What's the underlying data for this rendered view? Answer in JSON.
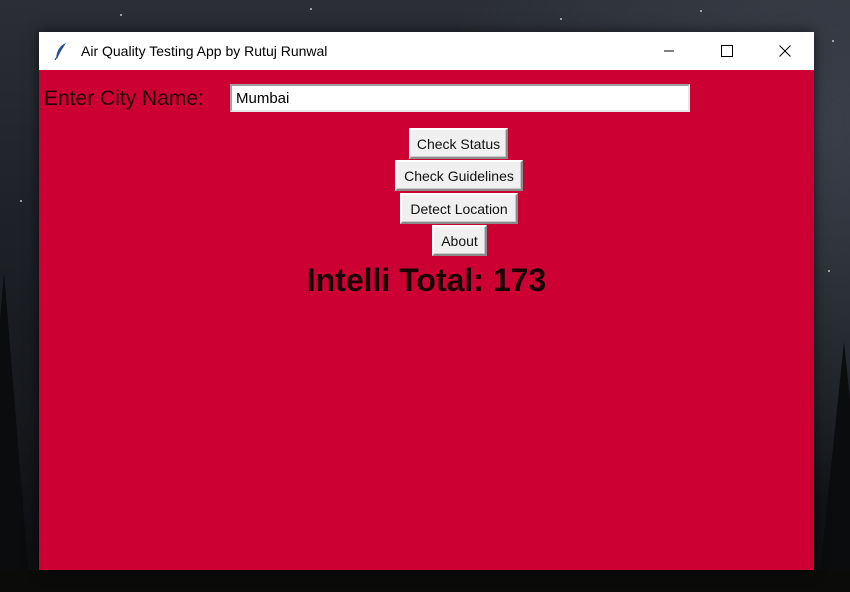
{
  "window": {
    "title": "Air Quality Testing App by Rutuj Runwal",
    "app_icon": "feather-icon",
    "controls": [
      "minimize-icon",
      "maximize-icon",
      "close-icon"
    ]
  },
  "form": {
    "city_label": "Enter City Name:",
    "city_value": "Mumbai"
  },
  "buttons": {
    "check_status": "Check Status",
    "check_guidelines": "Check Guidelines",
    "detect_location": "Detect Location",
    "about": "About"
  },
  "result": {
    "text": "Intelli Total: 173"
  },
  "colors": {
    "window_bg": "#cc0033",
    "titlebar_bg": "#ffffff",
    "button_bg": "#f0f0f0"
  }
}
